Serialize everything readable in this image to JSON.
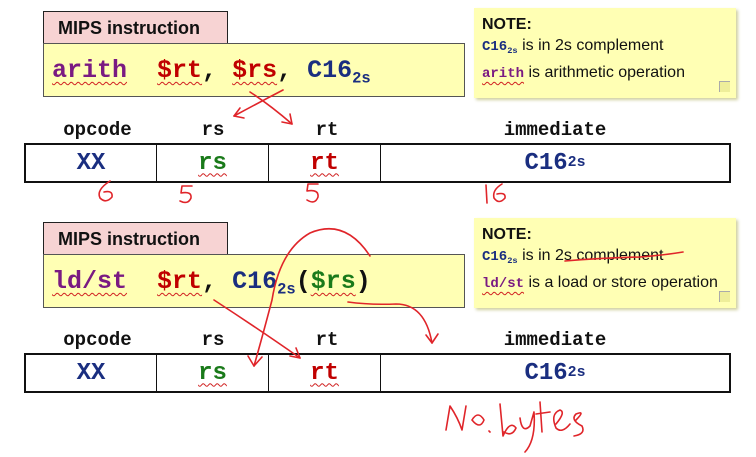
{
  "sections": [
    {
      "tab": "MIPS instruction",
      "instr": {
        "op": "arith",
        "arg1": "$rt",
        "sep1": ", ",
        "arg2": "$rs",
        "sep2": ", ",
        "imm": "C16",
        "imm_sub": "2s",
        "tail": ""
      },
      "note": {
        "title": "NOTE:",
        "l1_code": "C16",
        "l1_sub": "2s",
        "l1_text": " is in 2s complement",
        "l2_code": "arith",
        "l2_text": " is arithmetic operation"
      },
      "fields": {
        "headers": [
          "opcode",
          "rs",
          "rt",
          "immediate"
        ],
        "cells": [
          "XX",
          "rs",
          "rt",
          "C16"
        ],
        "imm_sub": "2s"
      },
      "annotations": [
        "6",
        "5",
        "5",
        "16"
      ]
    },
    {
      "tab": "MIPS instruction",
      "instr": {
        "op": "ld/st",
        "arg1": "$rt",
        "sep1": ", ",
        "imm": "C16",
        "imm_sub": "2s",
        "open": "(",
        "arg2": "$rs",
        "close": ")"
      },
      "note": {
        "title": "NOTE:",
        "l1_code": "C16",
        "l1_sub": "2s",
        "l1_text": " is in 2s complement",
        "l2_code": "ld/st",
        "l2_text": " is a load or store operation"
      },
      "fields": {
        "headers": [
          "opcode",
          "rs",
          "rt",
          "immediate"
        ],
        "cells": [
          "XX",
          "rs",
          "rt",
          "C16"
        ],
        "imm_sub": "2s"
      },
      "annotations": [
        "no. bytes"
      ]
    }
  ],
  "colors": {
    "tab_bg": "#f7d3d3",
    "box_bg": "#ffffb4",
    "opcode_purple": "#7a1a82",
    "reg_red": "#c00000",
    "reg_green": "#1a7a1a",
    "imm_blue": "#1a2e80",
    "ink_red": "#e0252a"
  }
}
